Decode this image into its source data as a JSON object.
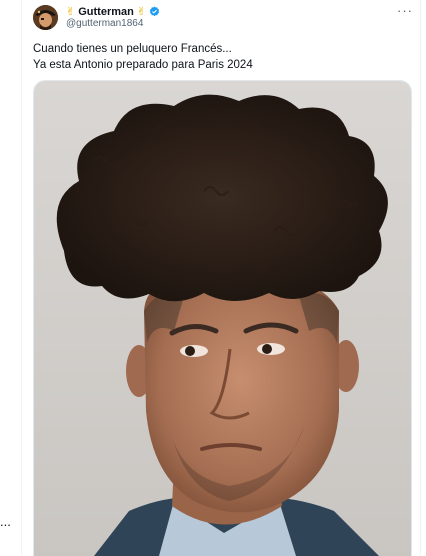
{
  "author": {
    "display_name": "Gutterman",
    "name_emoji": "✌",
    "handle": "@gutterman1864",
    "verified": true,
    "avatar_icon": "pirate-avatar-icon"
  },
  "tweet": {
    "lines": [
      "Cuando tienes un peluquero Francés...",
      "Ya esta Antonio preparado para Paris 2024"
    ]
  },
  "ui": {
    "more_label": "···",
    "side_more_label": "..."
  },
  "colors": {
    "verified_badge": "#1d9bf0",
    "muted_text": "#536471",
    "divider": "#eff3f4"
  }
}
